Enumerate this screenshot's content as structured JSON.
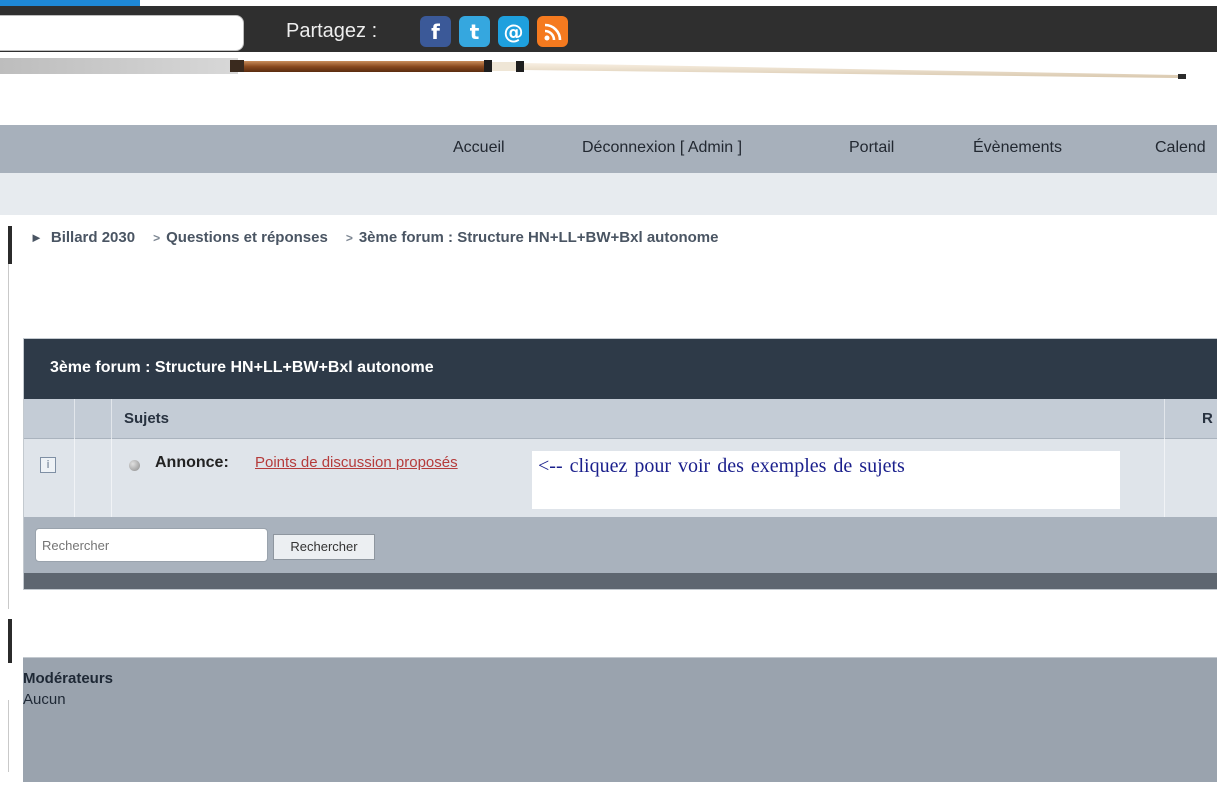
{
  "topbar": {
    "share_label": "Partagez :",
    "icons": [
      "facebook-icon",
      "twitter-icon",
      "email-icon",
      "rss-icon"
    ]
  },
  "nav": {
    "items": [
      "Accueil",
      "Déconnexion [ Admin ]",
      "Portail",
      "Évènements",
      "Calend"
    ]
  },
  "breadcrumb": {
    "items": [
      "Billard 2030",
      "Questions et réponses",
      "3ème forum : Structure HN+LL+BW+Bxl autonome"
    ]
  },
  "forum": {
    "title": "3ème forum : Structure HN+LL+BW+Bxl autonome",
    "col_sujets": "Sujets",
    "col_r": "R",
    "announcement": {
      "label": "Annonce:",
      "link": "Points de discussion proposés",
      "note": "<-- cliquez pour voir des exemples de sujets"
    },
    "search": {
      "placeholder": "Rechercher",
      "button": "Rechercher"
    }
  },
  "moderators": {
    "title": "Modérateurs",
    "value": "Aucun"
  },
  "colors": {
    "topbar": "#2f2f2f",
    "nav": "#a7b0bb",
    "panel_header": "#2e3a48",
    "link": "#b53b3b",
    "note_text": "#1a1f8c"
  }
}
